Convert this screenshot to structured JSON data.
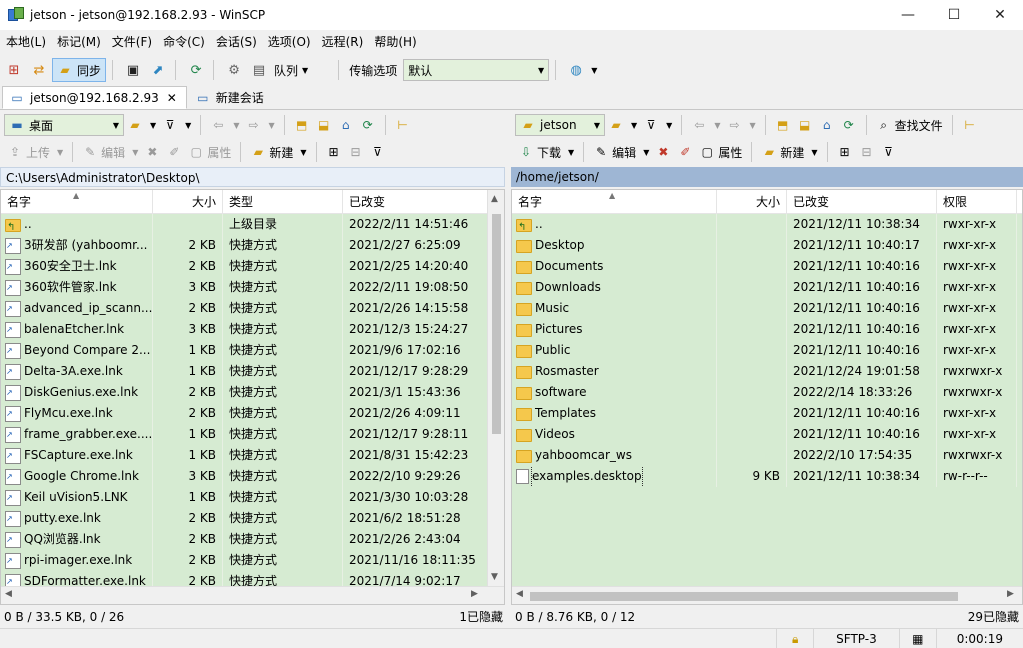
{
  "window": {
    "title": "jetson - jetson@192.168.2.93 - WinSCP",
    "minimize": "—",
    "maximize": "☐",
    "close": "✕"
  },
  "menu": [
    "本地(L)",
    "标记(M)",
    "文件(F)",
    "命令(C)",
    "会话(S)",
    "选项(O)",
    "远程(R)",
    "帮助(H)"
  ],
  "toolbar": {
    "sync_label": "同步",
    "queue_label": "队列",
    "transfer_label": "传输选项",
    "transfer_value": "默认"
  },
  "tabs": {
    "active": "jetson@192.168.2.93",
    "new_session": "新建会话"
  },
  "left_panel": {
    "location": "桌面",
    "upload": "上传",
    "edit": "编辑",
    "properties": "属性",
    "new": "新建",
    "path": "C:\\Users\\Administrator\\Desktop\\",
    "columns": {
      "name": "名字",
      "size": "大小",
      "type": "类型",
      "modified": "已改变"
    },
    "files": [
      {
        "name": "..",
        "size": "",
        "type": "上级目录",
        "modified": "2022/2/11  14:51:46",
        "icon": "up"
      },
      {
        "name": "3研发部 (yahboomr...",
        "size": "2 KB",
        "type": "快捷方式",
        "modified": "2021/2/27  6:25:09",
        "icon": "lnk"
      },
      {
        "name": "360安全卫士.lnk",
        "size": "2 KB",
        "type": "快捷方式",
        "modified": "2021/2/25  14:20:40",
        "icon": "lnk"
      },
      {
        "name": "360软件管家.lnk",
        "size": "3 KB",
        "type": "快捷方式",
        "modified": "2022/2/11  19:08:50",
        "icon": "lnk"
      },
      {
        "name": "advanced_ip_scann...",
        "size": "2 KB",
        "type": "快捷方式",
        "modified": "2021/2/26  14:15:58",
        "icon": "lnk"
      },
      {
        "name": "balenaEtcher.lnk",
        "size": "3 KB",
        "type": "快捷方式",
        "modified": "2021/12/3  15:24:27",
        "icon": "lnk"
      },
      {
        "name": "Beyond Compare 2...",
        "size": "1 KB",
        "type": "快捷方式",
        "modified": "2021/9/6  17:02:16",
        "icon": "lnk"
      },
      {
        "name": "Delta-3A.exe.lnk",
        "size": "1 KB",
        "type": "快捷方式",
        "modified": "2021/12/17  9:28:29",
        "icon": "lnk"
      },
      {
        "name": "DiskGenius.exe.lnk",
        "size": "2 KB",
        "type": "快捷方式",
        "modified": "2021/3/1  15:43:36",
        "icon": "lnk"
      },
      {
        "name": "FlyMcu.exe.lnk",
        "size": "2 KB",
        "type": "快捷方式",
        "modified": "2021/2/26  4:09:11",
        "icon": "lnk"
      },
      {
        "name": "frame_grabber.exe....",
        "size": "1 KB",
        "type": "快捷方式",
        "modified": "2021/12/17  9:28:11",
        "icon": "lnk"
      },
      {
        "name": "FSCapture.exe.lnk",
        "size": "1 KB",
        "type": "快捷方式",
        "modified": "2021/8/31  15:42:23",
        "icon": "lnk"
      },
      {
        "name": "Google Chrome.lnk",
        "size": "3 KB",
        "type": "快捷方式",
        "modified": "2022/2/10  9:29:26",
        "icon": "lnk"
      },
      {
        "name": "Keil uVision5.LNK",
        "size": "1 KB",
        "type": "快捷方式",
        "modified": "2021/3/30  10:03:28",
        "icon": "lnk"
      },
      {
        "name": "putty.exe.lnk",
        "size": "2 KB",
        "type": "快捷方式",
        "modified": "2021/6/2  18:51:28",
        "icon": "lnk"
      },
      {
        "name": "QQ浏览器.lnk",
        "size": "2 KB",
        "type": "快捷方式",
        "modified": "2021/2/26  2:43:04",
        "icon": "lnk"
      },
      {
        "name": "rpi-imager.exe.lnk",
        "size": "2 KB",
        "type": "快捷方式",
        "modified": "2021/11/16  18:11:35",
        "icon": "lnk"
      },
      {
        "name": "SDFormatter.exe.lnk",
        "size": "2 KB",
        "type": "快捷方式",
        "modified": "2021/7/14  9:02:17",
        "icon": "lnk"
      }
    ],
    "status_left": "0 B / 33.5 KB,  0 / 26",
    "status_right": "1已隐藏"
  },
  "right_panel": {
    "location": "jetson",
    "download": "下载",
    "edit": "编辑",
    "properties": "属性",
    "new": "新建",
    "find": "查找文件",
    "path": "/home/jetson/",
    "columns": {
      "name": "名字",
      "size": "大小",
      "modified": "已改变",
      "rights": "权限"
    },
    "files": [
      {
        "name": "..",
        "size": "",
        "modified": "2021/12/11 10:38:34",
        "rights": "rwxr-xr-x",
        "icon": "up"
      },
      {
        "name": "Desktop",
        "size": "",
        "modified": "2021/12/11 10:40:17",
        "rights": "rwxr-xr-x",
        "icon": "folder"
      },
      {
        "name": "Documents",
        "size": "",
        "modified": "2021/12/11 10:40:16",
        "rights": "rwxr-xr-x",
        "icon": "folder"
      },
      {
        "name": "Downloads",
        "size": "",
        "modified": "2021/12/11 10:40:16",
        "rights": "rwxr-xr-x",
        "icon": "folder"
      },
      {
        "name": "Music",
        "size": "",
        "modified": "2021/12/11 10:40:16",
        "rights": "rwxr-xr-x",
        "icon": "folder"
      },
      {
        "name": "Pictures",
        "size": "",
        "modified": "2021/12/11 10:40:16",
        "rights": "rwxr-xr-x",
        "icon": "folder"
      },
      {
        "name": "Public",
        "size": "",
        "modified": "2021/12/11 10:40:16",
        "rights": "rwxr-xr-x",
        "icon": "folder"
      },
      {
        "name": "Rosmaster",
        "size": "",
        "modified": "2021/12/24 19:01:58",
        "rights": "rwxrwxr-x",
        "icon": "folder"
      },
      {
        "name": "software",
        "size": "",
        "modified": "2022/2/14 18:33:26",
        "rights": "rwxrwxr-x",
        "icon": "folder"
      },
      {
        "name": "Templates",
        "size": "",
        "modified": "2021/12/11 10:40:16",
        "rights": "rwxr-xr-x",
        "icon": "folder"
      },
      {
        "name": "Videos",
        "size": "",
        "modified": "2021/12/11 10:40:16",
        "rights": "rwxr-xr-x",
        "icon": "folder"
      },
      {
        "name": "yahboomcar_ws",
        "size": "",
        "modified": "2022/2/10 17:54:35",
        "rights": "rwxrwxr-x",
        "icon": "folder"
      },
      {
        "name": "examples.desktop",
        "size": "9 KB",
        "modified": "2021/12/11 10:38:34",
        "rights": "rw-r--r--",
        "icon": "doc"
      }
    ],
    "status_left": "0 B / 8.76 KB,  0 / 12",
    "status_right": "29已隐藏"
  },
  "statusbar": {
    "protocol": "SFTP-3",
    "elapsed": "0:00:19"
  }
}
